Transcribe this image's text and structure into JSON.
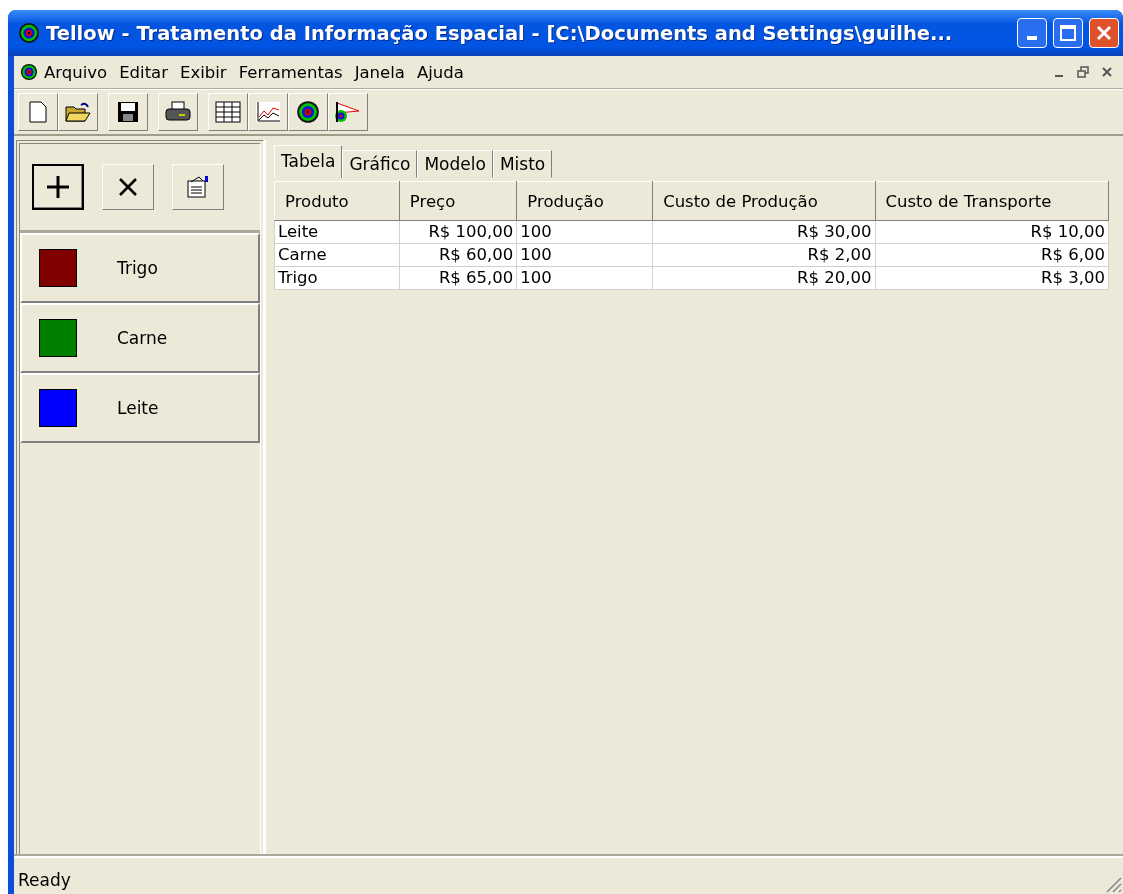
{
  "window": {
    "title": "Tellow - Tratamento da Informação Espacial - [C:\\Documents and Settings\\guilhe..."
  },
  "menu": [
    "Arquivo",
    "Editar",
    "Exibir",
    "Ferramentas",
    "Janela",
    "Ajuda"
  ],
  "legend": [
    {
      "label": "Trigo",
      "color": "#800000"
    },
    {
      "label": "Carne",
      "color": "#008000"
    },
    {
      "label": "Leite",
      "color": "#0000ff"
    }
  ],
  "tabs": [
    {
      "label": "Tabela",
      "selected": true
    },
    {
      "label": "Gráfico",
      "selected": false
    },
    {
      "label": "Modelo",
      "selected": false
    },
    {
      "label": "Misto",
      "selected": false
    }
  ],
  "table": {
    "columns": [
      "Produto",
      "Preço",
      "Produção",
      "Custo de Produção",
      "Custo de Transporte"
    ],
    "rows": [
      [
        "Leite",
        "R$ 100,00",
        "100",
        "R$ 30,00",
        "R$ 10,00"
      ],
      [
        "Carne",
        "R$ 60,00",
        "100",
        "R$ 2,00",
        "R$ 6,00"
      ],
      [
        "Trigo",
        "R$ 65,00",
        "100",
        "R$ 20,00",
        "R$ 3,00"
      ]
    ]
  },
  "status_bar": "Ready"
}
